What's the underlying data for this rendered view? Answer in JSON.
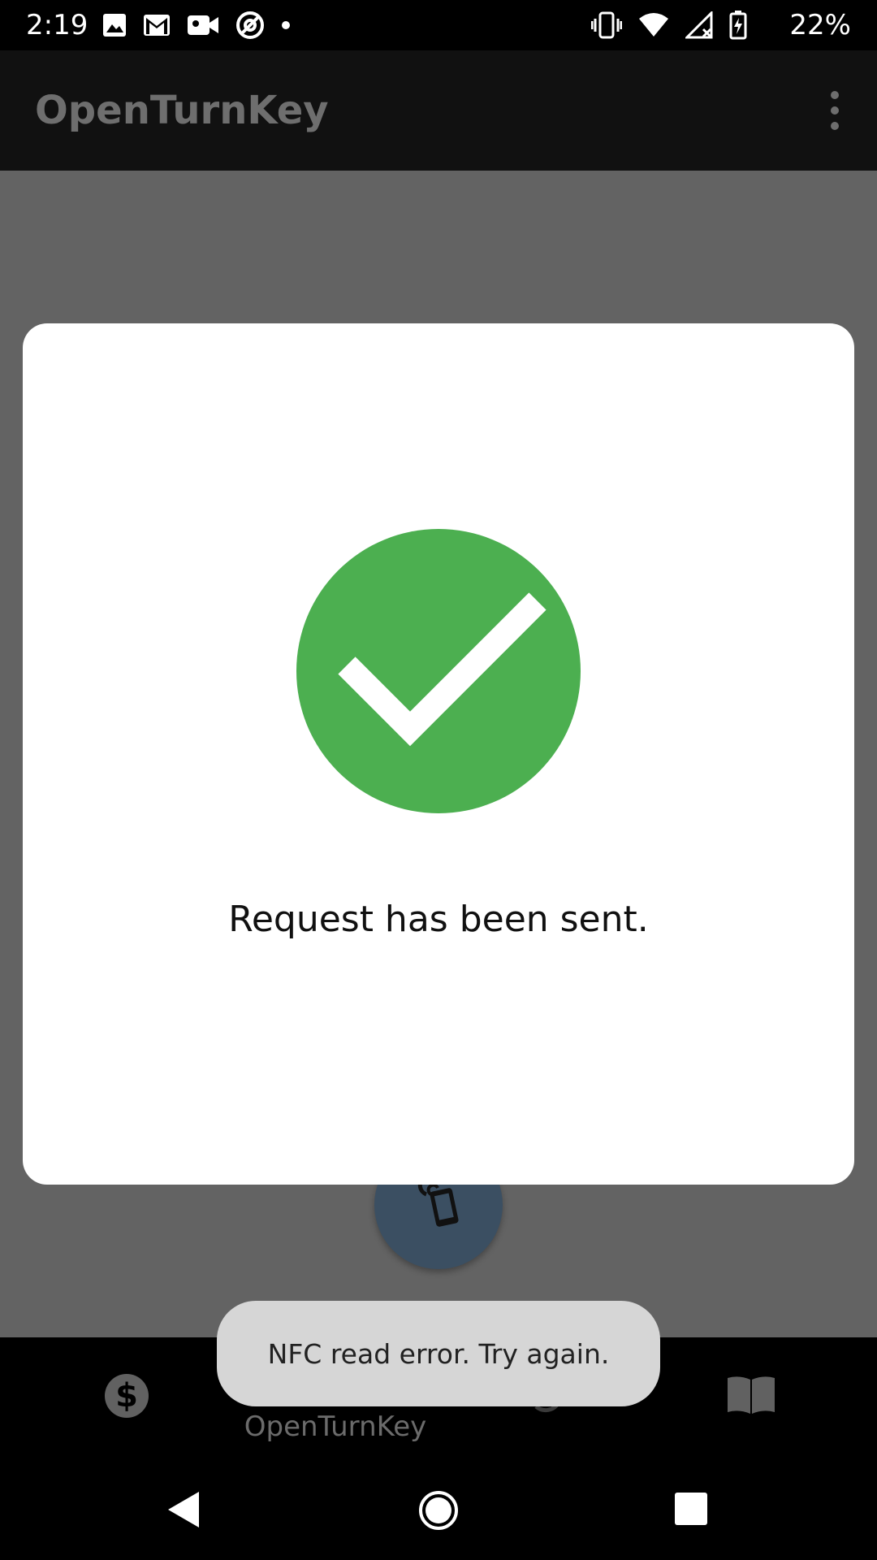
{
  "status_bar": {
    "time": "2:19",
    "battery": "22%",
    "icons_left": [
      "image-icon",
      "gmail-icon",
      "video-icon",
      "at-icon",
      "dot-icon"
    ],
    "icons_right": [
      "vibrate-icon",
      "wifi-icon",
      "signal-icon",
      "battery-charging-icon"
    ]
  },
  "app_bar": {
    "title": "OpenTurnKey",
    "menu_icon": "overflow-menu-icon"
  },
  "dialog": {
    "icon": "check-circle-icon",
    "icon_color": "#4caf50",
    "message": "Request has been sent."
  },
  "fab": {
    "icon": "nfc-phone-icon",
    "color": "#3b4f62"
  },
  "bottom_nav": {
    "items": [
      {
        "icon": "dollar-icon",
        "label": ""
      },
      {
        "icon": "key-check-icon",
        "label": "OpenTurnKey"
      },
      {
        "icon": "history-icon",
        "label": ""
      },
      {
        "icon": "book-icon",
        "label": ""
      }
    ]
  },
  "toast": {
    "message": "NFC read error. Try again."
  },
  "system_nav": {
    "buttons": [
      "back-icon",
      "home-icon",
      "recents-icon"
    ]
  }
}
